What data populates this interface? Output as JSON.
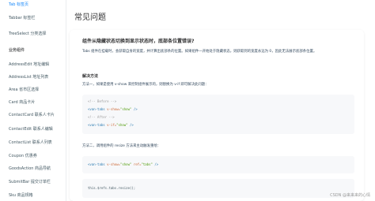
{
  "sidebar": {
    "items": [
      {
        "label": "Tab 标签页",
        "active": true
      },
      {
        "label": "Tabbar 标签栏"
      },
      {
        "label": "TreeSelect 分类选择"
      }
    ],
    "group_title": "业务组件",
    "group_items": [
      "AddressEdit 地址编辑",
      "AddressList 地址列表",
      "Area 省市区选择",
      "Card 商品卡片",
      "ContactCard 联系人卡片",
      "ContactEdit 联系人编辑",
      "ContactList 联系人列表",
      "Coupon 优惠券",
      "GoodsAction 商品导航",
      "SubmitBar 提交订单栏",
      "Sku 商品规格"
    ]
  },
  "main": {
    "title": "常见问题",
    "question": "组件从隐藏状态切换到显示状态时，底部条位置错误?",
    "description": "Tabs 组件在挂载时，会获取自身的宽度，并计算出底部条的位置。如果组件一开始处于隐藏状态，则获取到的宽度永远为 0，因此无法展示底部条位置。",
    "solution_heading": "解决方法",
    "method1": "方法一，如果是使用  v-show  来控制组件展示的，则替换为  v-if  即可解决此问题：",
    "code1": {
      "c1": "<!-- Before -->",
      "l1_tag": "<van-tabs",
      "l1_attr": " v-show=",
      "l1_str": "\"show\"",
      "l1_end": " />",
      "c2": "<!-- After -->",
      "l2_tag": "<van-tabs",
      "l2_attr": " v-if=",
      "l2_str": "\"show\"",
      "l2_end": " />"
    },
    "method2": "方法二，调用组件的 resize 方法来主动触发重绘：",
    "code2": {
      "tag": "<van-tabs",
      "attr1": " v-show=",
      "str1": "\"show\"",
      "attr2": " ref=",
      "str2": "\"tabs\"",
      "end": " />"
    },
    "code3": "this.$refs.tabs.resize();"
  },
  "watermark": "CSDN @来来来的心情"
}
